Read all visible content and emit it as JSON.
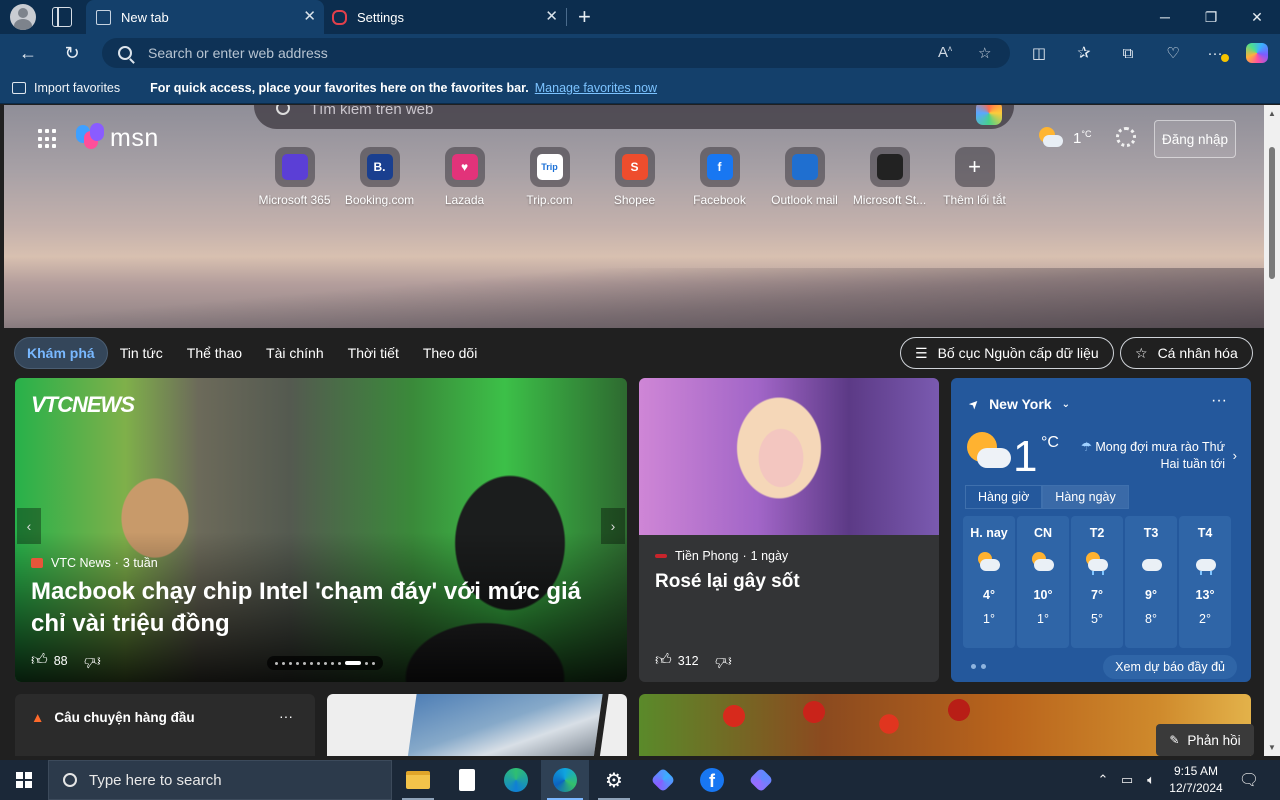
{
  "browser": {
    "tabs": [
      {
        "title": "New tab",
        "active": true
      },
      {
        "title": "Settings",
        "active": false
      }
    ],
    "close_symbol": "✕",
    "new_tab_symbol": "+",
    "window_controls": {
      "minimize": "─",
      "restore": "❐",
      "close": "✕"
    },
    "address_placeholder": "Search or enter web address",
    "toolbar_icons": [
      "back-icon",
      "refresh-icon",
      "read-aloud-icon",
      "favorite-star-icon",
      "split-screen-icon",
      "favorites-icon",
      "collections-icon",
      "browser-essentials-icon",
      "more-menu-icon",
      "copilot-icon"
    ],
    "favorites_bar": {
      "import_label": "Import favorites",
      "message": "For quick access, place your favorites here on the favorites bar.",
      "manage_link": "Manage favorites now"
    }
  },
  "msn": {
    "logo_text": "msn",
    "search_placeholder": "Tìm kiếm trên web",
    "header_weather_temp": "1",
    "header_weather_unit": "°C",
    "signin_label": "Đăng nhập",
    "shortcuts": [
      {
        "label": "Microsoft 365",
        "glyph": "",
        "color": "#5b3fd6"
      },
      {
        "label": "Booking.com",
        "glyph": "B.",
        "color": "#1a3f8f"
      },
      {
        "label": "Lazada",
        "glyph": "♥",
        "color": "#e2337a"
      },
      {
        "label": "Trip.com",
        "glyph": "Trip",
        "color": "#ffffff"
      },
      {
        "label": "Shopee",
        "glyph": "S",
        "color": "#ee4d2d"
      },
      {
        "label": "Facebook",
        "glyph": "f",
        "color": "#1877f2"
      },
      {
        "label": "Outlook mail",
        "glyph": "",
        "color": "#1f6fd0"
      },
      {
        "label": "Microsoft St...",
        "glyph": "",
        "color": "#222222"
      },
      {
        "label": "Thêm lối tắt",
        "glyph": "+",
        "color": "transparent"
      }
    ],
    "nav_tabs": [
      "Khám phá",
      "Tin tức",
      "Thể thao",
      "Tài chính",
      "Thời tiết",
      "Theo dõi"
    ],
    "layout_button": "Bố cục Nguồn cấp dữ liệu",
    "personalize_button": "Cá nhân hóa",
    "main_story": {
      "logo": "VTCNEWS",
      "source": "VTC News",
      "age": "3 tuần",
      "title": "Macbook chạy chip Intel 'chạm đáy' với mức giá chỉ vài triệu đồng",
      "likes": "88"
    },
    "second_story": {
      "source": "Tiền Phong",
      "age": "1 ngày",
      "title": "Rosé lại gây sốt",
      "likes": "312"
    },
    "weather": {
      "location": "New York",
      "more": "···",
      "temp": "1",
      "unit": "°C",
      "forecast_note": "Mong đợi mưa rào Thứ Hai tuần tới",
      "tabs": [
        "Hàng giờ",
        "Hàng ngày"
      ],
      "active_tab": 1,
      "days": [
        {
          "day": "H. nay",
          "hi": "4°",
          "lo": "1°",
          "icon": "partly-sunny",
          "rain": false
        },
        {
          "day": "CN",
          "hi": "10°",
          "lo": "1°",
          "icon": "mostly-sunny",
          "rain": false
        },
        {
          "day": "T2",
          "hi": "7°",
          "lo": "5°",
          "icon": "sun-rain",
          "rain": true
        },
        {
          "day": "T3",
          "hi": "9°",
          "lo": "8°",
          "icon": "cloudy",
          "rain": false
        },
        {
          "day": "T4",
          "hi": "13°",
          "lo": "2°",
          "icon": "rain",
          "rain": true
        }
      ],
      "full_forecast": "Xem dự báo đầy đủ"
    },
    "top_stories_title": "Câu chuyện hàng đầu",
    "top_stories_more": "···",
    "feedback_label": "Phản hồi"
  },
  "taskbar": {
    "search_placeholder": "Type here to search",
    "apps": [
      "file-explorer-icon",
      "notepad-icon",
      "edge-dev-icon",
      "edge-icon",
      "settings-icon",
      "copilot-icon",
      "facebook-icon",
      "copilot-alt-icon"
    ],
    "time": "9:15 AM",
    "date": "12/7/2024"
  }
}
